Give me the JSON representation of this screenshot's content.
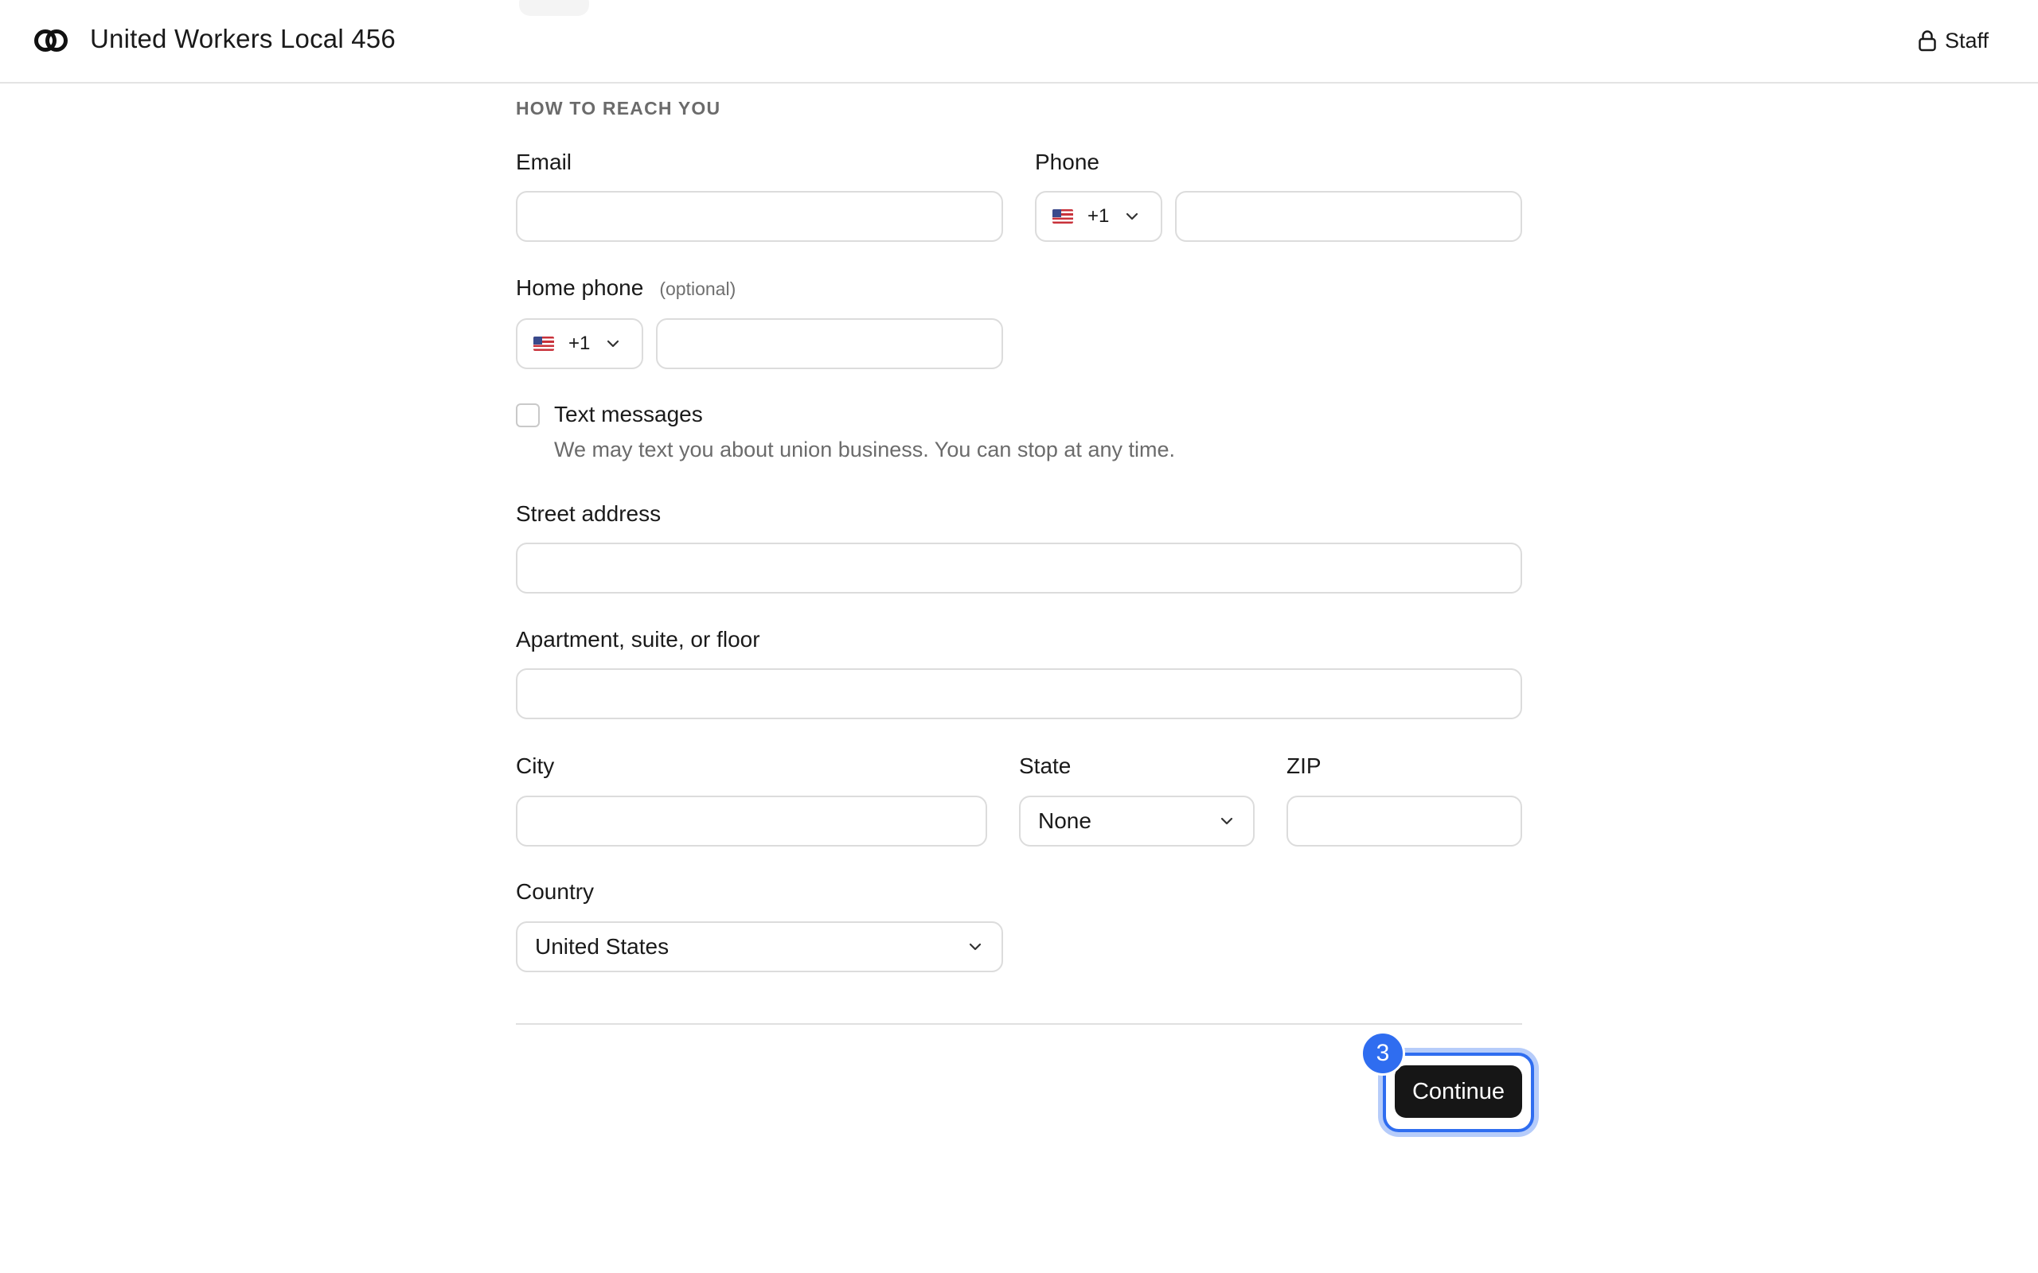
{
  "header": {
    "org_name": "United Workers Local 456",
    "staff_label": "Staff"
  },
  "form": {
    "section_title": "HOW TO REACH YOU",
    "email": {
      "label": "Email",
      "value": ""
    },
    "phone": {
      "label": "Phone",
      "country_code": "+1",
      "flag": "us-flag",
      "value": ""
    },
    "home_phone": {
      "label": "Home phone",
      "optional": "(optional)",
      "country_code": "+1",
      "flag": "us-flag",
      "value": ""
    },
    "text_messages": {
      "label": "Text messages",
      "help": "We may text you about union business. You can stop at any time.",
      "checked": false
    },
    "street": {
      "label": "Street address",
      "value": ""
    },
    "apartment": {
      "label": "Apartment, suite, or floor",
      "value": ""
    },
    "city": {
      "label": "City",
      "value": ""
    },
    "state": {
      "label": "State",
      "value": "None"
    },
    "zip": {
      "label": "ZIP",
      "value": ""
    },
    "country": {
      "label": "Country",
      "value": "United States"
    }
  },
  "actions": {
    "continue_label": "Continue",
    "step_badge": "3"
  },
  "colors": {
    "accent": "#2f6df0",
    "button_bg": "#161616"
  }
}
